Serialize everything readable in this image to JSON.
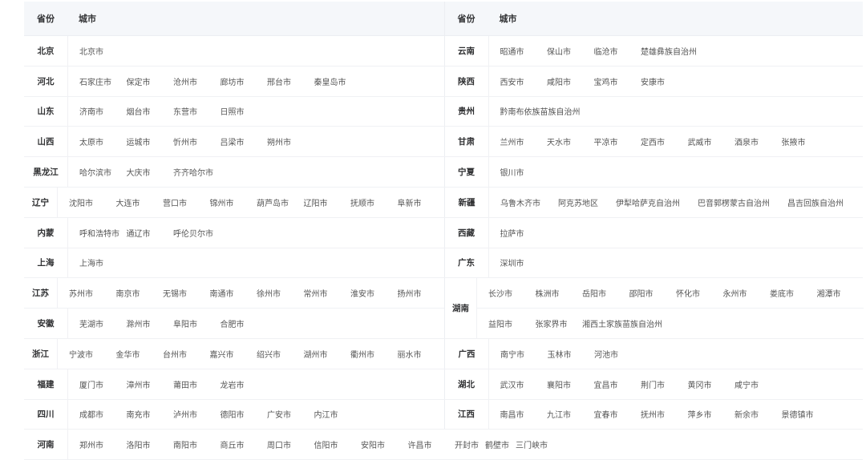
{
  "headers": {
    "province": "省份",
    "city": "城市"
  },
  "rows": [
    {
      "left": {
        "province": "北京",
        "cities": [
          "北京市"
        ]
      },
      "right": {
        "province": "云南",
        "cities": [
          "昭通市",
          "保山市",
          "临沧市",
          "楚雄彝族自治州"
        ]
      }
    },
    {
      "left": {
        "province": "河北",
        "cities": [
          "石家庄市",
          "保定市",
          "沧州市",
          "廊坊市",
          "邢台市",
          "秦皇岛市"
        ]
      },
      "right": {
        "province": "陕西",
        "cities": [
          "西安市",
          "咸阳市",
          "宝鸡市",
          "安康市"
        ]
      }
    },
    {
      "left": {
        "province": "山东",
        "cities": [
          "济南市",
          "烟台市",
          "东营市",
          "日照市"
        ]
      },
      "right": {
        "province": "贵州",
        "cities": [
          "黔南布依族苗族自治州"
        ]
      }
    },
    {
      "left": {
        "province": "山西",
        "cities": [
          "太原市",
          "运城市",
          "忻州市",
          "吕梁市",
          "朔州市"
        ]
      },
      "right": {
        "province": "甘肃",
        "cities": [
          "兰州市",
          "天水市",
          "平凉市",
          "定西市",
          "武威市",
          "酒泉市",
          "张掖市"
        ]
      }
    },
    {
      "left": {
        "province": "黑龙江",
        "cities": [
          "哈尔滨市",
          "大庆市",
          "齐齐哈尔市"
        ]
      },
      "right": {
        "province": "宁夏",
        "cities": [
          "银川市"
        ]
      }
    },
    {
      "left": {
        "province": "辽宁",
        "cities": [
          "沈阳市",
          "大连市",
          "营口市",
          "锦州市",
          "葫芦岛市",
          "辽阳市",
          "抚顺市",
          "阜新市"
        ]
      },
      "right": {
        "province": "新疆",
        "cities": [
          "乌鲁木齐市",
          "阿克苏地区",
          "伊犁哈萨克自治州",
          "巴音郭楞蒙古自治州",
          "昌吉回族自治州"
        ]
      }
    },
    {
      "left": {
        "province": "内蒙",
        "cities": [
          "呼和浩特市",
          "通辽市",
          "呼伦贝尔市"
        ]
      },
      "right": {
        "province": "西藏",
        "cities": [
          "拉萨市"
        ]
      }
    },
    {
      "left": {
        "province": "上海",
        "cities": [
          "上海市"
        ]
      },
      "right": {
        "province": "广东",
        "cities": [
          "深圳市"
        ]
      }
    }
  ],
  "split_rows": {
    "left": [
      {
        "province": "江苏",
        "cities": [
          "苏州市",
          "南京市",
          "无锡市",
          "南通市",
          "徐州市",
          "常州市",
          "淮安市",
          "扬州市"
        ]
      },
      {
        "province": "安徽",
        "cities": [
          "芜湖市",
          "滁州市",
          "阜阳市",
          "合肥市"
        ]
      }
    ],
    "right": {
      "province": "湖南",
      "lines": [
        [
          "长沙市",
          "株洲市",
          "岳阳市",
          "邵阳市",
          "怀化市",
          "永州市",
          "娄底市",
          "湘潭市"
        ],
        [
          "益阳市",
          "张家界市",
          "湘西土家族苗族自治州"
        ]
      ]
    }
  },
  "rows2": [
    {
      "left": {
        "province": "浙江",
        "cities": [
          "宁波市",
          "金华市",
          "台州市",
          "嘉兴市",
          "绍兴市",
          "湖州市",
          "衢州市",
          "丽水市"
        ]
      },
      "right": {
        "province": "广西",
        "cities": [
          "南宁市",
          "玉林市",
          "河池市"
        ]
      }
    },
    {
      "left": {
        "province": "福建",
        "cities": [
          "厦门市",
          "漳州市",
          "莆田市",
          "龙岩市"
        ]
      },
      "right": {
        "province": "湖北",
        "cities": [
          "武汉市",
          "襄阳市",
          "宜昌市",
          "荆门市",
          "黄冈市",
          "咸宁市"
        ]
      }
    },
    {
      "left": {
        "province": "四川",
        "cities": [
          "成都市",
          "南充市",
          "泸州市",
          "德阳市",
          "广安市",
          "内江市"
        ]
      },
      "right": {
        "province": "江西",
        "cities": [
          "南昌市",
          "九江市",
          "宜春市",
          "抚州市",
          "萍乡市",
          "新余市",
          "景德镇市"
        ]
      }
    }
  ],
  "last_row": {
    "province": "河南",
    "cities": [
      "郑州市",
      "洛阳市",
      "南阳市",
      "商丘市",
      "周口市",
      "信阳市",
      "安阳市",
      "许昌市",
      "开封市",
      "鹤壁市",
      "三门峡市"
    ]
  }
}
